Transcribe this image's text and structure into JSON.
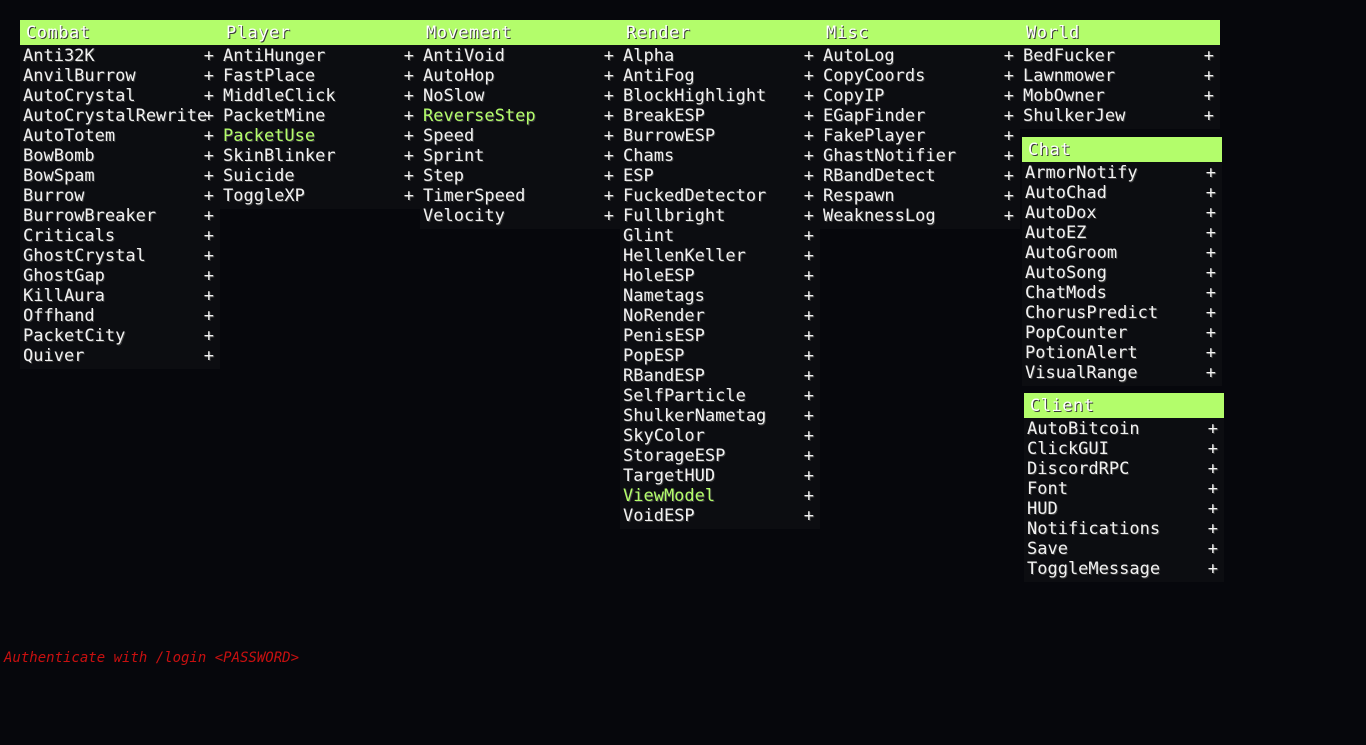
{
  "theme": {
    "accent": "#b3fd6b",
    "background": "#06070c",
    "panel": "#0c0d11",
    "warning": "#c81010"
  },
  "plus_icon": "+",
  "panels": [
    {
      "title": "Combat",
      "items": [
        {
          "label": "Anti32K",
          "on": false
        },
        {
          "label": "AnvilBurrow",
          "on": false
        },
        {
          "label": "AutoCrystal",
          "on": false
        },
        {
          "label": "AutoCrystalRewrite",
          "on": false
        },
        {
          "label": "AutoTotem",
          "on": false
        },
        {
          "label": "BowBomb",
          "on": false
        },
        {
          "label": "BowSpam",
          "on": false
        },
        {
          "label": "Burrow",
          "on": false
        },
        {
          "label": "BurrowBreaker",
          "on": false
        },
        {
          "label": "Criticals",
          "on": false
        },
        {
          "label": "GhostCrystal",
          "on": false
        },
        {
          "label": "GhostGap",
          "on": false
        },
        {
          "label": "KillAura",
          "on": false
        },
        {
          "label": "Offhand",
          "on": false
        },
        {
          "label": "PacketCity",
          "on": false
        },
        {
          "label": "Quiver",
          "on": false
        }
      ]
    },
    {
      "title": "Player",
      "items": [
        {
          "label": "AntiHunger",
          "on": false
        },
        {
          "label": "FastPlace",
          "on": false
        },
        {
          "label": "MiddleClick",
          "on": false
        },
        {
          "label": "PacketMine",
          "on": false
        },
        {
          "label": "PacketUse",
          "on": true
        },
        {
          "label": "SkinBlinker",
          "on": false
        },
        {
          "label": "Suicide",
          "on": false
        },
        {
          "label": "ToggleXP",
          "on": false
        }
      ]
    },
    {
      "title": "Movement",
      "items": [
        {
          "label": "AntiVoid",
          "on": false
        },
        {
          "label": "AutoHop",
          "on": false
        },
        {
          "label": "NoSlow",
          "on": false
        },
        {
          "label": "ReverseStep",
          "on": true
        },
        {
          "label": "Speed",
          "on": false
        },
        {
          "label": "Sprint",
          "on": false
        },
        {
          "label": "Step",
          "on": false
        },
        {
          "label": "TimerSpeed",
          "on": false
        },
        {
          "label": "Velocity",
          "on": false
        }
      ]
    },
    {
      "title": "Render",
      "items": [
        {
          "label": "Alpha",
          "on": false
        },
        {
          "label": "AntiFog",
          "on": false
        },
        {
          "label": "BlockHighlight",
          "on": false
        },
        {
          "label": "BreakESP",
          "on": false
        },
        {
          "label": "BurrowESP",
          "on": false
        },
        {
          "label": "Chams",
          "on": false
        },
        {
          "label": "ESP",
          "on": false
        },
        {
          "label": "FuckedDetector",
          "on": false
        },
        {
          "label": "Fullbright",
          "on": false
        },
        {
          "label": "Glint",
          "on": false
        },
        {
          "label": "HellenKeller",
          "on": false
        },
        {
          "label": "HoleESP",
          "on": false
        },
        {
          "label": "Nametags",
          "on": false
        },
        {
          "label": "NoRender",
          "on": false
        },
        {
          "label": "PenisESP",
          "on": false
        },
        {
          "label": "PopESP",
          "on": false
        },
        {
          "label": "RBandESP",
          "on": false
        },
        {
          "label": "SelfParticle",
          "on": false
        },
        {
          "label": "ShulkerNametag",
          "on": false
        },
        {
          "label": "SkyColor",
          "on": false
        },
        {
          "label": "StorageESP",
          "on": false
        },
        {
          "label": "TargetHUD",
          "on": false
        },
        {
          "label": "ViewModel",
          "on": true
        },
        {
          "label": "VoidESP",
          "on": false
        }
      ]
    },
    {
      "title": "Misc",
      "items": [
        {
          "label": "AutoLog",
          "on": false
        },
        {
          "label": "CopyCoords",
          "on": false
        },
        {
          "label": "CopyIP",
          "on": false
        },
        {
          "label": "EGapFinder",
          "on": false
        },
        {
          "label": "FakePlayer",
          "on": false
        },
        {
          "label": "GhastNotifier",
          "on": false
        },
        {
          "label": "RBandDetect",
          "on": false
        },
        {
          "label": "Respawn",
          "on": false
        },
        {
          "label": "WeaknessLog",
          "on": false
        }
      ]
    },
    {
      "title": "World",
      "items": [
        {
          "label": "BedFucker",
          "on": false
        },
        {
          "label": "Lawnmower",
          "on": false
        },
        {
          "label": "MobOwner",
          "on": false
        },
        {
          "label": "ShulkerJew",
          "on": false
        }
      ]
    },
    {
      "title": "Chat",
      "items": [
        {
          "label": "ArmorNotify",
          "on": false
        },
        {
          "label": "AutoChad",
          "on": false
        },
        {
          "label": "AutoDox",
          "on": false
        },
        {
          "label": "AutoEZ",
          "on": false
        },
        {
          "label": "AutoGroom",
          "on": false
        },
        {
          "label": "AutoSong",
          "on": false
        },
        {
          "label": "ChatMods",
          "on": false
        },
        {
          "label": "ChorusPredict",
          "on": false
        },
        {
          "label": "PopCounter",
          "on": false
        },
        {
          "label": "PotionAlert",
          "on": false
        },
        {
          "label": "VisualRange",
          "on": false
        }
      ]
    },
    {
      "title": "Client",
      "items": [
        {
          "label": "AutoBitcoin",
          "on": false
        },
        {
          "label": "ClickGUI",
          "on": false
        },
        {
          "label": "DiscordRPC",
          "on": false
        },
        {
          "label": "Font",
          "on": false
        },
        {
          "label": "HUD",
          "on": false
        },
        {
          "label": "Notifications",
          "on": false
        },
        {
          "label": "Save",
          "on": false
        },
        {
          "label": "ToggleMessage",
          "on": false
        }
      ]
    }
  ],
  "auth_message": "Authenticate with /login <PASSWORD>"
}
